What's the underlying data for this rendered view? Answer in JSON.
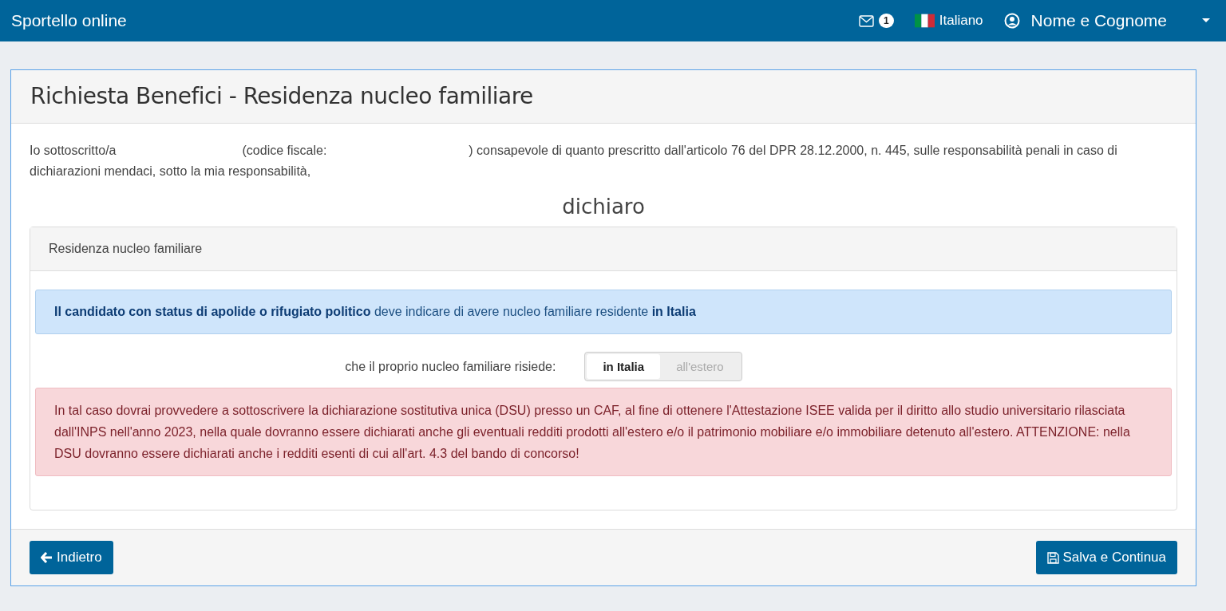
{
  "navbar": {
    "brand": "Sportello online",
    "messages_count": "1",
    "language": "Italiano",
    "user": "Nome e Cognome"
  },
  "page": {
    "title": "Richiesta Benefici - Residenza nucleo familiare",
    "intro_parts": [
      "Io sottoscritto/a",
      "(codice fiscale:",
      ") consapevole di quanto prescritto dall'articolo 76 del DPR 28.12.2000, n. 445, sulle responsabilità penali in caso di dichiarazioni mendaci, sotto la mia responsabilità,"
    ],
    "heading": "dichiaro",
    "panel": {
      "title": "Residenza nucleo familiare",
      "info": "**Il candidato con status di apolide o rifugiato politico** deve indicare di avere nucleo familiare residente **in Italia**",
      "question": "che il proprio nucleo familiare risiede:",
      "options": [
        {
          "label": "in Italia",
          "selected": true
        },
        {
          "label": "all'estero",
          "selected": false
        }
      ],
      "warning": "In tal caso dovrai provvedere a sottoscrivere la dichiarazione sostitutiva unica (DSU) presso un CAF, al fine di ottenere l'Attestazione ISEE valida per il diritto allo studio universitario rilasciata dall'INPS nell'anno 2023, nella quale dovranno essere dichiarati anche gli eventuali redditi prodotti all'estero e/o il patrimonio mobiliare e/o immobiliare detenuto all'estero. ATTENZIONE: nella DSU dovranno essere dichiarati anche i redditi esenti di cui all'art. 4.3 del bando di concorso!"
    },
    "back_button": "Indietro",
    "save_button": "Salva e Continua"
  }
}
